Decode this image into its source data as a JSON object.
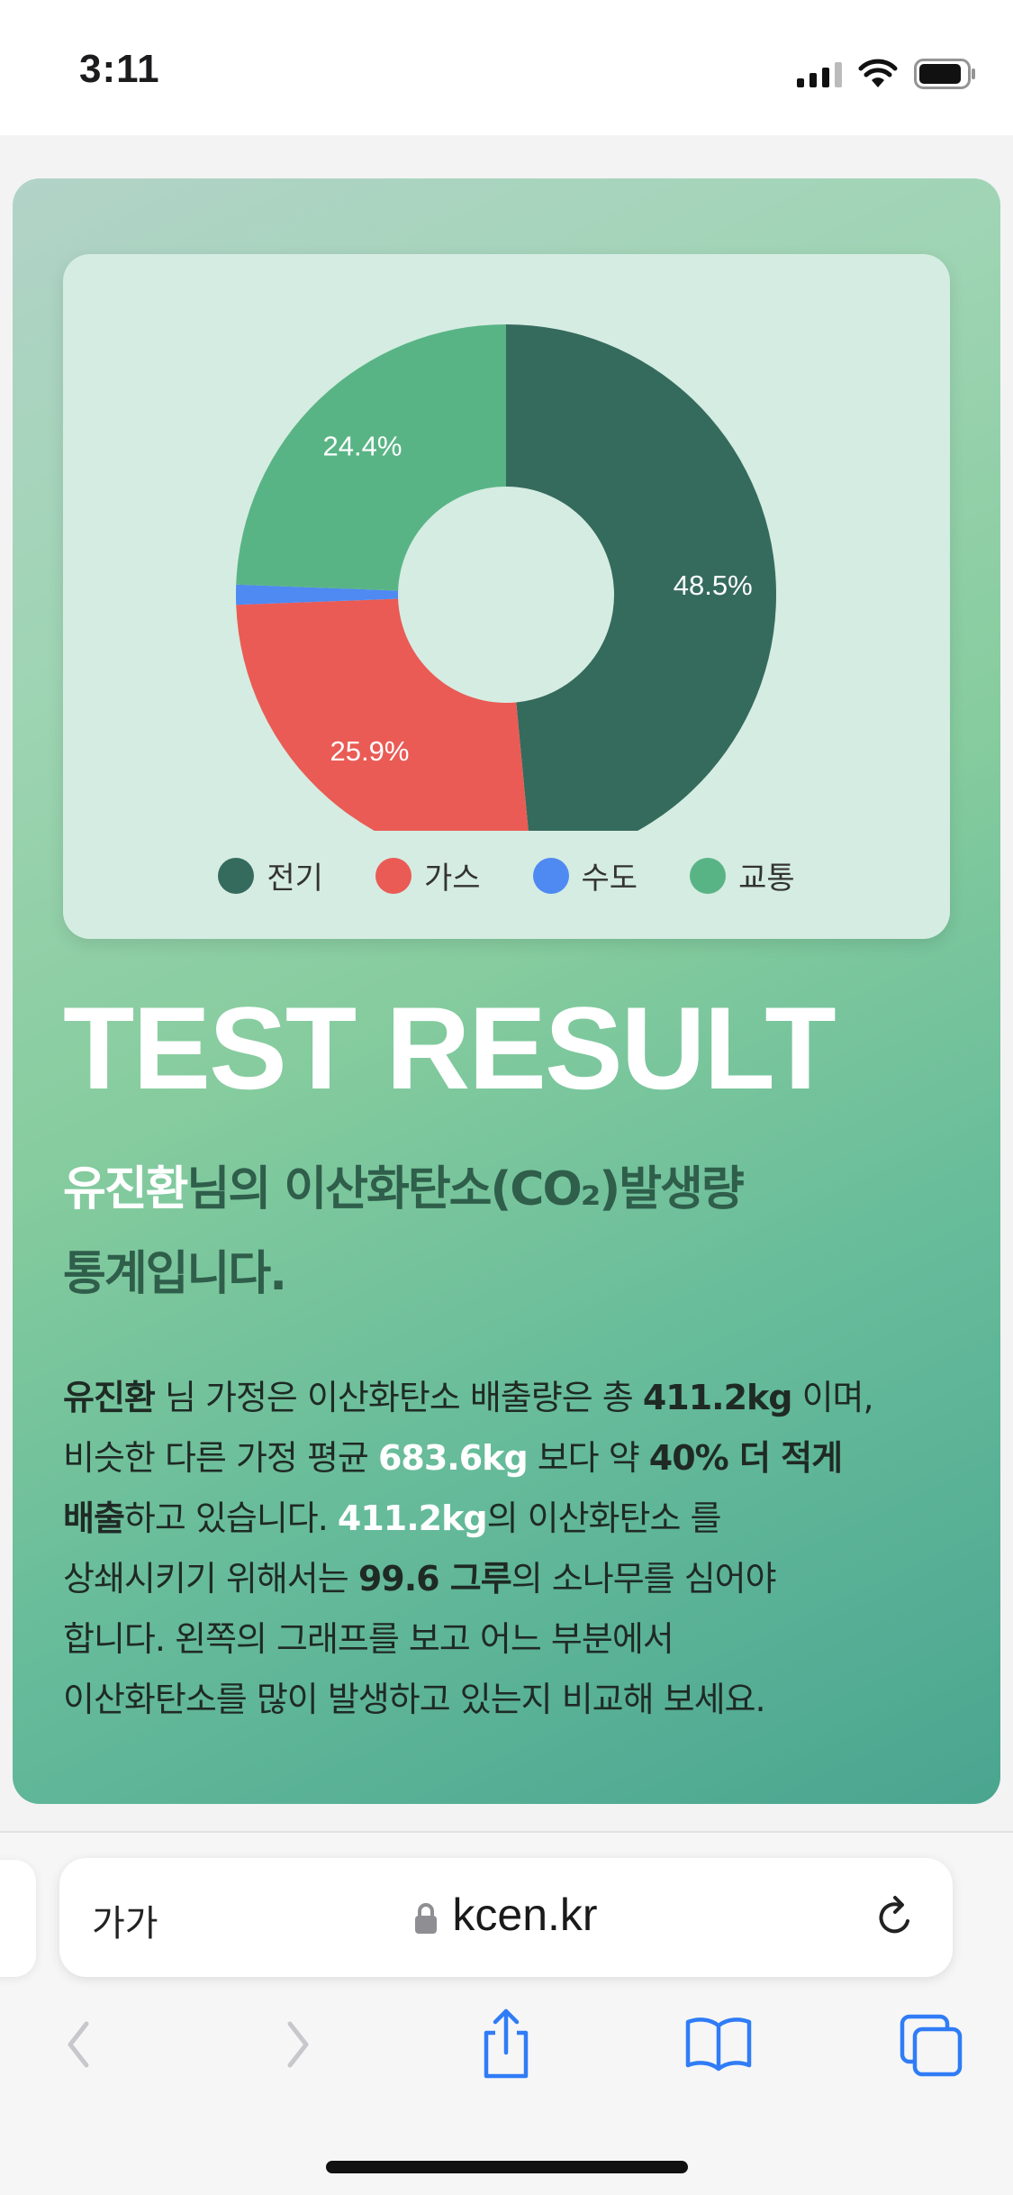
{
  "status_bar": {
    "time": "3:11"
  },
  "chart_data": {
    "type": "pie",
    "variant": "donut",
    "categories": [
      "전기",
      "가스",
      "수도",
      "교통"
    ],
    "values": [
      48.5,
      25.9,
      1.2,
      24.4
    ],
    "labels": [
      "48.5%",
      "25.9%",
      "",
      "24.4%"
    ],
    "colors": [
      "#356b5d",
      "#ea5b55",
      "#4f89f2",
      "#59b485"
    ],
    "legend_position": "bottom"
  },
  "result": {
    "title": "TEST RESULT",
    "subtitle_name": "유진환",
    "subtitle_rest_line1": "님의 이산화탄소(CO₂)발생량",
    "subtitle_line2": "통계입니다.",
    "desc": {
      "name": "유진환",
      "t1": " 님 가정은 이산화탄소 배출량은 총 ",
      "total": "411.2kg",
      "t2": " 이며,",
      "t3": "비슷한 다른 가정 평균 ",
      "avg": "683.6kg",
      "t4": " 보다 약 ",
      "percent": "40% 더 적게",
      "emit": "배출",
      "t5": "하고 있습니다. ",
      "total2": "411.2kg",
      "t6": "의 이산화탄소 를",
      "t7": "상쇄시키기 위해서는 ",
      "trees": "99.6 그루",
      "t8": "의 소나무를 심어야",
      "t9": "합니다. 왼쪽의 그래프를 보고 어느 부분에서",
      "t10": "이산화탄소를 많이 발생하고 있는지 비교해 보세요."
    }
  },
  "browser": {
    "text_size_label": "가가",
    "url": "kcen.kr"
  },
  "icons": {
    "back": "chevron-left-icon",
    "forward": "chevron-right-icon",
    "share": "share-icon",
    "bookmarks": "book-icon",
    "tabs": "tabs-icon"
  }
}
